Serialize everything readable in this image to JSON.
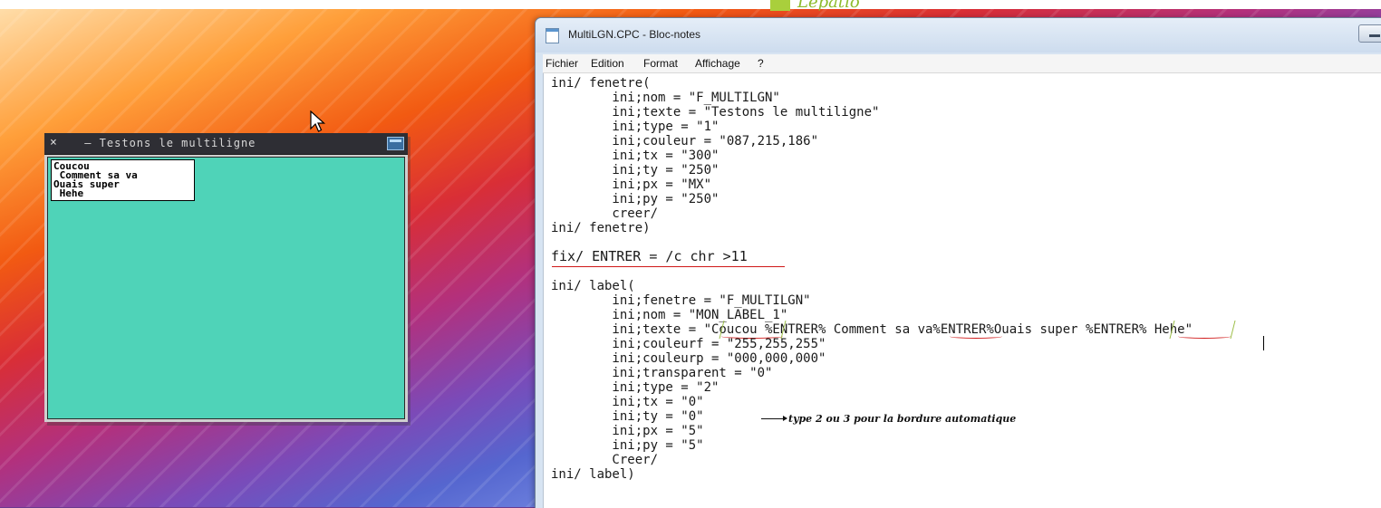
{
  "desktop": {
    "logo_text": "Lepatio"
  },
  "cpc_window": {
    "close_symbol": "×",
    "title": " — Testons le multiligne",
    "label_lines": [
      "Coucou",
      " Comment sa va",
      "Ouais super",
      " Hehe"
    ],
    "client_color": "#4fd3b8"
  },
  "notepad": {
    "title": "MultiLGN.CPC - Bloc-notes",
    "menu": [
      "Fichier",
      "Edition",
      "Format",
      "Affichage",
      "?"
    ],
    "lines": [
      "ini/ fenetre(",
      "        ini;nom = \"F_MULTILGN\"",
      "        ini;texte = \"Testons le multiligne\"",
      "        ini;type = \"1\"",
      "        ini;couleur = \"087,215,186\"",
      "        ini;tx = \"300\"",
      "        ini;ty = \"250\"",
      "        ini;px = \"MX\"",
      "        ini;py = \"250\"",
      "        creer/",
      "ini/ fenetre)",
      "fix/ ENTRER = /c chr >11",
      "ini/ label(",
      "        ini;fenetre = \"F_MULTILGN\"",
      "        ini;nom = \"MON_LABEL_1\"",
      "        ini;texte = \"Coucou %ENTRER% Comment sa va%ENTRER%Ouais super %ENTRER% Hehe\"",
      "        ini;couleurf = \"255,255,255\"",
      "        ini;couleurp = \"000,000,000\"",
      "        ini;transparent = \"0\"",
      "        ini;type = \"2\"",
      "        ini;tx = \"0\"",
      "        ini;ty = \"0\"",
      "        ini;px = \"5\"",
      "        ini;py = \"5\"",
      "        Creer/",
      "ini/ label)"
    ],
    "annotation": "type 2 ou 3 pour la bordure automatique"
  }
}
